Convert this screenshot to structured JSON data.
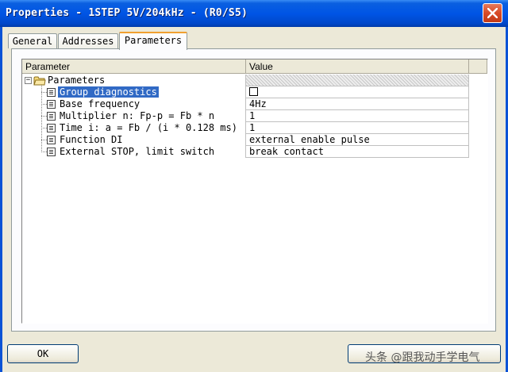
{
  "window": {
    "title": "Properties - 1STEP 5V/204kHz - (R0/S5)",
    "close_icon": "close-x-icon"
  },
  "tabs": [
    {
      "label": "General",
      "active": false
    },
    {
      "label": "Addresses",
      "active": false
    },
    {
      "label": "Parameters",
      "active": true
    }
  ],
  "grid": {
    "columns": [
      "Parameter",
      "Value"
    ],
    "root": {
      "label": "Parameters",
      "icon": "folder-icon",
      "expander": "minus"
    },
    "rows": [
      {
        "name": "Group diagnostics",
        "value": "",
        "type": "checkbox",
        "checked": false,
        "selected": true
      },
      {
        "name": "Base frequency",
        "value": "4Hz"
      },
      {
        "name": "Multiplier n: Fp-p = Fb * n",
        "value": "1"
      },
      {
        "name": "Time i: a = Fb / (i * 0.128 ms)",
        "value": "1"
      },
      {
        "name": "Function DI",
        "value": "external enable pulse"
      },
      {
        "name": "External STOP, limit switch",
        "value": "break contact"
      }
    ]
  },
  "buttons": {
    "ok": "OK",
    "cancel": ""
  },
  "watermark": "头条 @跟我动手学电气",
  "colors": {
    "titlebar": "#0055e5",
    "selection": "#316ac5",
    "active_tab_accent": "#f0a030"
  }
}
